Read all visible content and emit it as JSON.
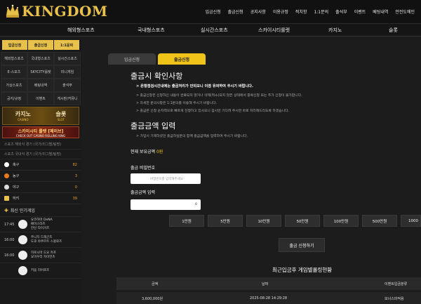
{
  "brand": {
    "name": "KINGDOM"
  },
  "topnav": [
    "입금신청",
    "출금신청",
    "공지사항",
    "이용규정",
    "적치항",
    "1:1문의",
    "출석부",
    "이벤트",
    "베팅내역",
    "안전도메인"
  ],
  "mainnav": [
    "해외형스포츠",
    "국내형스포츠",
    "실시간스포츠",
    "스카이시티룰렛",
    "카지노",
    "슬롯"
  ],
  "sidebar": {
    "tabs": [
      "입금신청",
      "출금신청",
      "1:1문의"
    ],
    "grid": [
      "해외형스포츠",
      "국내형스포츠",
      "실시간스포츠",
      "E-스포츠",
      "SKYCITY룰렛",
      "미니게임",
      "가상스포츠",
      "베팅내역",
      "출석부",
      "공지/규정",
      "이벤트",
      "게시판/커뮤니"
    ],
    "banner_casino": "카지노",
    "banner_casino_sub": "CASINO",
    "banner_slot": "슬롯",
    "banner_slot_sub": "SLOT",
    "banner_event": "스카이시티 룰렛 [메이브]",
    "banner_event_sub": "CHECK OUT CASINO ROLLING KING",
    "link1": "스포츠 해외식 경기 (국가/리그별/팀명)",
    "link2": "스포츠 국내식 경기 (국가/리그별/팀명)",
    "sports": [
      {
        "name": "축구",
        "count": "82",
        "color": "#ffffff"
      },
      {
        "name": "농구",
        "count": "3",
        "color": "#e87a20"
      },
      {
        "name": "야구",
        "count": "0",
        "color": "#dddddd"
      },
      {
        "name": "하키",
        "count": "39",
        "color": "#e8c14a"
      }
    ],
    "popular_title": "최신 인기게임",
    "games": [
      {
        "time": "17:45",
        "teams": "요코하마 DeNA\n베이스타즈\n한신 타이거즈"
      },
      {
        "time": "16:00",
        "teams": "주니치 드래곤즈\n도쿄 야쿠르트 스왈로즈"
      },
      {
        "time": "16:00",
        "teams": "히로시마 도요 카프\n요미우리 자이언츠"
      },
      {
        "time": "",
        "teams": "키움 히어로즈"
      }
    ]
  },
  "content": {
    "tab_deposit": "입금신청",
    "tab_withdraw": "출금신청",
    "notice_title": "출금시 확인사항",
    "notice_bold": "> 은행점검시간내에는 출금처리가 안되오니 이점 유의하여 주시기 바랍니다.",
    "notice_lines": [
      "> 출금신청은 신청하신 내용이 완료되지 않거나 삭제(취소)되지 않은 상태에서 중복신청 또는 추가 신청이 불가합니다.",
      "> 자세한 문의사항은 1:1문의를 이용해 주시기 바랍니다.",
      "> 출금은 신청 순차적으로 빠르게 진행하고 있사오니 잠시만 기다려 주시면 바로 처리해드리도록 하겠습니다."
    ],
    "amount_title": "출금금액 입력",
    "amount_note": "> 가입시 기재하셨던 출금하실분의 함께 출금금액을 입력하여 주시기 바랍니다.",
    "balance_label": "현재 보유금액",
    "balance_value": "0원",
    "pw_label": "출금 비밀번호",
    "pw_placeholder": "비밀번호를 입력해주세요",
    "amt_label": "출금금액 입력",
    "amt_value": "0",
    "amount_buttons": [
      "1만원",
      "5만원",
      "10만원",
      "50만원",
      "100만원",
      "500만원",
      "1000"
    ],
    "submit": "출금 신청하기",
    "recent_title": "최근입금후 게임별롤링현황",
    "table_headers": [
      "금액",
      "날짜",
      "이벤트입금분류"
    ],
    "table_rows": [
      [
        "3,600,000원",
        "2025-08-28 14:29:28",
        "보너스마적용"
      ]
    ]
  }
}
